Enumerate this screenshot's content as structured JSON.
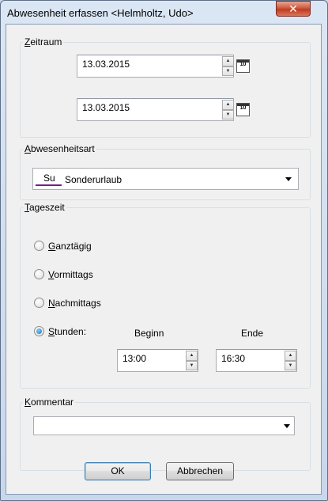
{
  "window": {
    "title": "Abwesenheit erfassen <Helmholtz, Udo>",
    "close_symbol": "✕"
  },
  "zeitraum": {
    "legend": "Zeitraum",
    "legend_underline": "Z",
    "legend_rest": "eitraum",
    "from_date": "13.03.2015",
    "to_date": "13.03.2015",
    "calendar_glyph": "10"
  },
  "abwesenheitsart": {
    "legend_underline": "A",
    "legend_rest": "bwesenheitsart",
    "code": "Su",
    "code_color": "#7a1b8c",
    "selected": "Sonderurlaub"
  },
  "tageszeit": {
    "legend_underline": "T",
    "legend_rest": "ageszeit",
    "options": [
      {
        "underline": "G",
        "rest": "anztägig",
        "checked": false
      },
      {
        "underline": "V",
        "rest": "ormittags",
        "checked": false
      },
      {
        "underline": "N",
        "rest": "achmittags",
        "checked": false
      },
      {
        "underline": "S",
        "rest": "tunden:",
        "checked": true
      }
    ],
    "begin_label": "Beginn",
    "end_label": "Ende",
    "begin_value": "13:00",
    "end_value": "16:30"
  },
  "kommentar": {
    "legend_underline": "K",
    "legend_rest": "ommentar",
    "value": ""
  },
  "buttons": {
    "ok": "OK",
    "cancel": "Abbrechen"
  },
  "colors": {
    "accent": "#3c7fb1",
    "close": "#c03a20"
  }
}
